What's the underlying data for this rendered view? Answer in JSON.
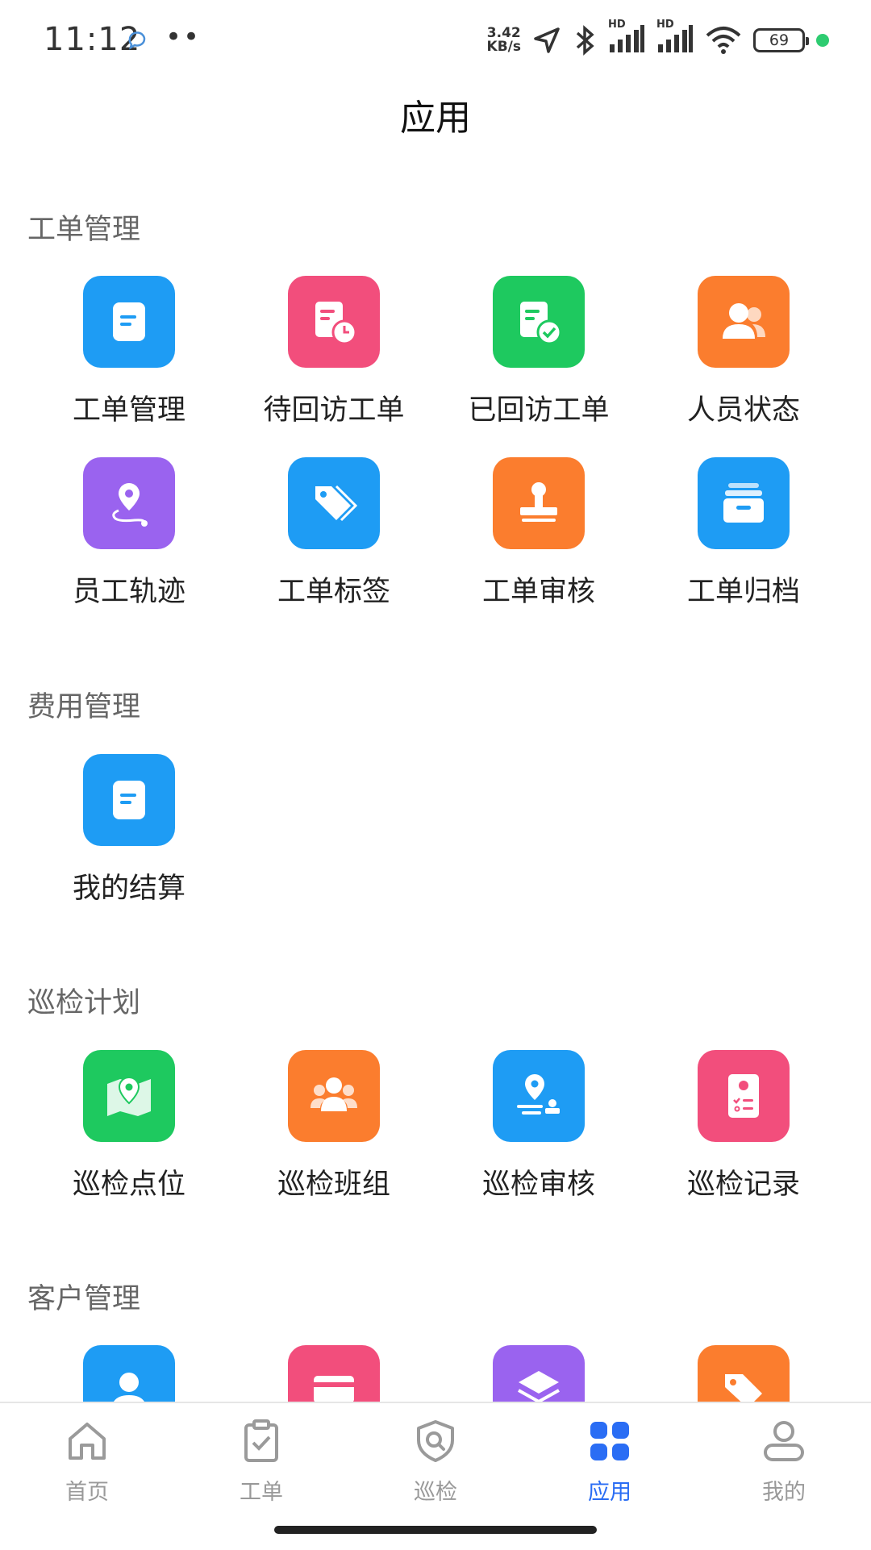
{
  "status_bar": {
    "time": "11:12",
    "dots": "••",
    "net_speed_value": "3.42",
    "net_speed_unit": "KB/s",
    "hd1": "HD",
    "hd2": "HD",
    "battery": "69",
    "icons": [
      "chat-bubble-icon",
      "location-arrow-icon",
      "bluetooth-icon",
      "signal-icon",
      "wifi-icon",
      "battery-icon"
    ]
  },
  "header": {
    "title": "应用"
  },
  "sections": [
    {
      "title": "工单管理",
      "items": [
        {
          "label": "工单管理",
          "icon": "note-icon",
          "color": "#1e9cf4"
        },
        {
          "label": "待回访工单",
          "icon": "doc-clock-icon",
          "color": "#f24e7c"
        },
        {
          "label": "已回访工单",
          "icon": "doc-check-icon",
          "color": "#1ec95f"
        },
        {
          "label": "人员状态",
          "icon": "people-icon",
          "color": "#fb7d2e"
        },
        {
          "label": "员工轨迹",
          "icon": "route-pin-icon",
          "color": "#9a63ef"
        },
        {
          "label": "工单标签",
          "icon": "tags-icon",
          "color": "#1e9cf4"
        },
        {
          "label": "工单审核",
          "icon": "stamp-icon",
          "color": "#fb7d2e"
        },
        {
          "label": "工单归档",
          "icon": "archive-box-icon",
          "color": "#1e9cf4"
        }
      ]
    },
    {
      "title": "费用管理",
      "items": [
        {
          "label": "我的结算",
          "icon": "note-icon",
          "color": "#1e9cf4"
        }
      ]
    },
    {
      "title": "巡检计划",
      "items": [
        {
          "label": "巡检点位",
          "icon": "map-pin-icon",
          "color": "#1ec95f"
        },
        {
          "label": "巡检班组",
          "icon": "group-icon",
          "color": "#fb7d2e"
        },
        {
          "label": "巡检审核",
          "icon": "pin-stamp-icon",
          "color": "#1e9cf4"
        },
        {
          "label": "巡检记录",
          "icon": "record-list-icon",
          "color": "#f24e7c"
        }
      ]
    },
    {
      "title": "客户管理",
      "items": [
        {
          "label": "",
          "icon": "person-icon",
          "color": "#1e9cf4"
        },
        {
          "label": "",
          "icon": "card-icon",
          "color": "#f24e7c"
        },
        {
          "label": "",
          "icon": "layers-icon",
          "color": "#9a63ef"
        },
        {
          "label": "",
          "icon": "tag-icon",
          "color": "#fb7d2e"
        }
      ]
    }
  ],
  "tab_bar": {
    "active": "应用",
    "active_color": "#2a6df4",
    "tabs": [
      {
        "label": "首页",
        "icon": "home-icon"
      },
      {
        "label": "工单",
        "icon": "clipboard-check-icon"
      },
      {
        "label": "巡检",
        "icon": "shield-search-icon"
      },
      {
        "label": "应用",
        "icon": "grid-apps-icon"
      },
      {
        "label": "我的",
        "icon": "user-icon"
      }
    ]
  }
}
